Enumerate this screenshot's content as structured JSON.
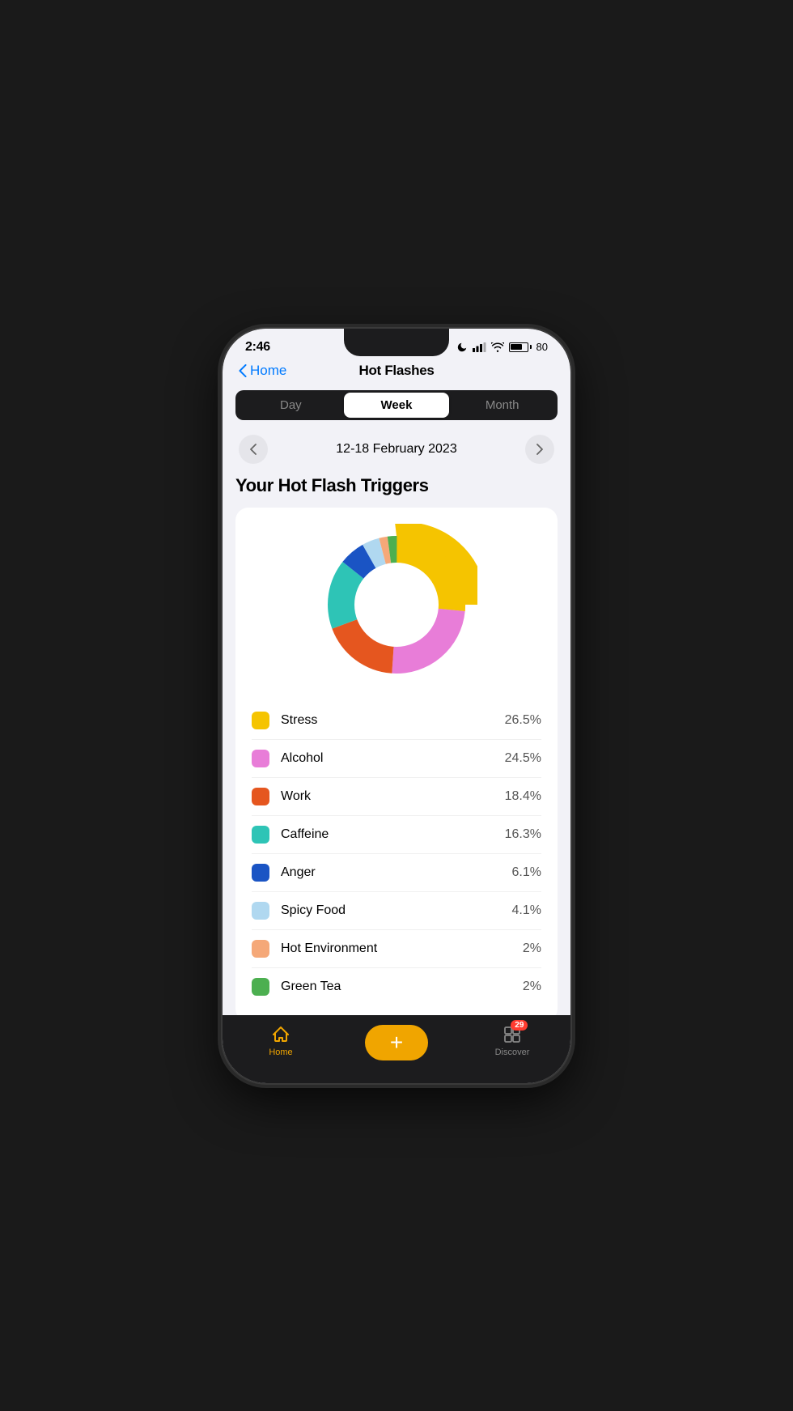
{
  "status": {
    "time": "2:46",
    "battery": "80"
  },
  "nav": {
    "back_label": "Home",
    "title": "Hot Flashes"
  },
  "segment": {
    "items": [
      "Day",
      "Week",
      "Month"
    ],
    "active": "Week"
  },
  "date_nav": {
    "range": "12-18 February 2023",
    "prev_label": "‹",
    "next_label": "›"
  },
  "chart_section": {
    "title": "Your Hot Flash Triggers"
  },
  "legend": [
    {
      "label": "Stress",
      "value": "26.5%",
      "color": "#f5c400",
      "segment_color": "#f5c400"
    },
    {
      "label": "Alcohol",
      "value": "24.5%",
      "color": "#e87dd8",
      "segment_color": "#e87dd8"
    },
    {
      "label": "Work",
      "value": "18.4%",
      "color": "#e5561f",
      "segment_color": "#e5561f"
    },
    {
      "label": "Caffeine",
      "value": "16.3%",
      "color": "#2ec4b6",
      "segment_color": "#2ec4b6"
    },
    {
      "label": "Anger",
      "value": "6.1%",
      "color": "#1a54c4",
      "segment_color": "#1a54c4"
    },
    {
      "label": "Spicy Food",
      "value": "4.1%",
      "color": "#b0d8f0",
      "segment_color": "#b0d8f0"
    },
    {
      "label": "Hot Environment",
      "value": "2%",
      "color": "#f5a878",
      "segment_color": "#f5a878"
    },
    {
      "label": "Green Tea",
      "value": "2%",
      "color": "#4caf50",
      "segment_color": "#4caf50"
    }
  ],
  "tabs": {
    "home_label": "Home",
    "add_label": "+",
    "discover_label": "Discover",
    "discover_badge": "29"
  }
}
